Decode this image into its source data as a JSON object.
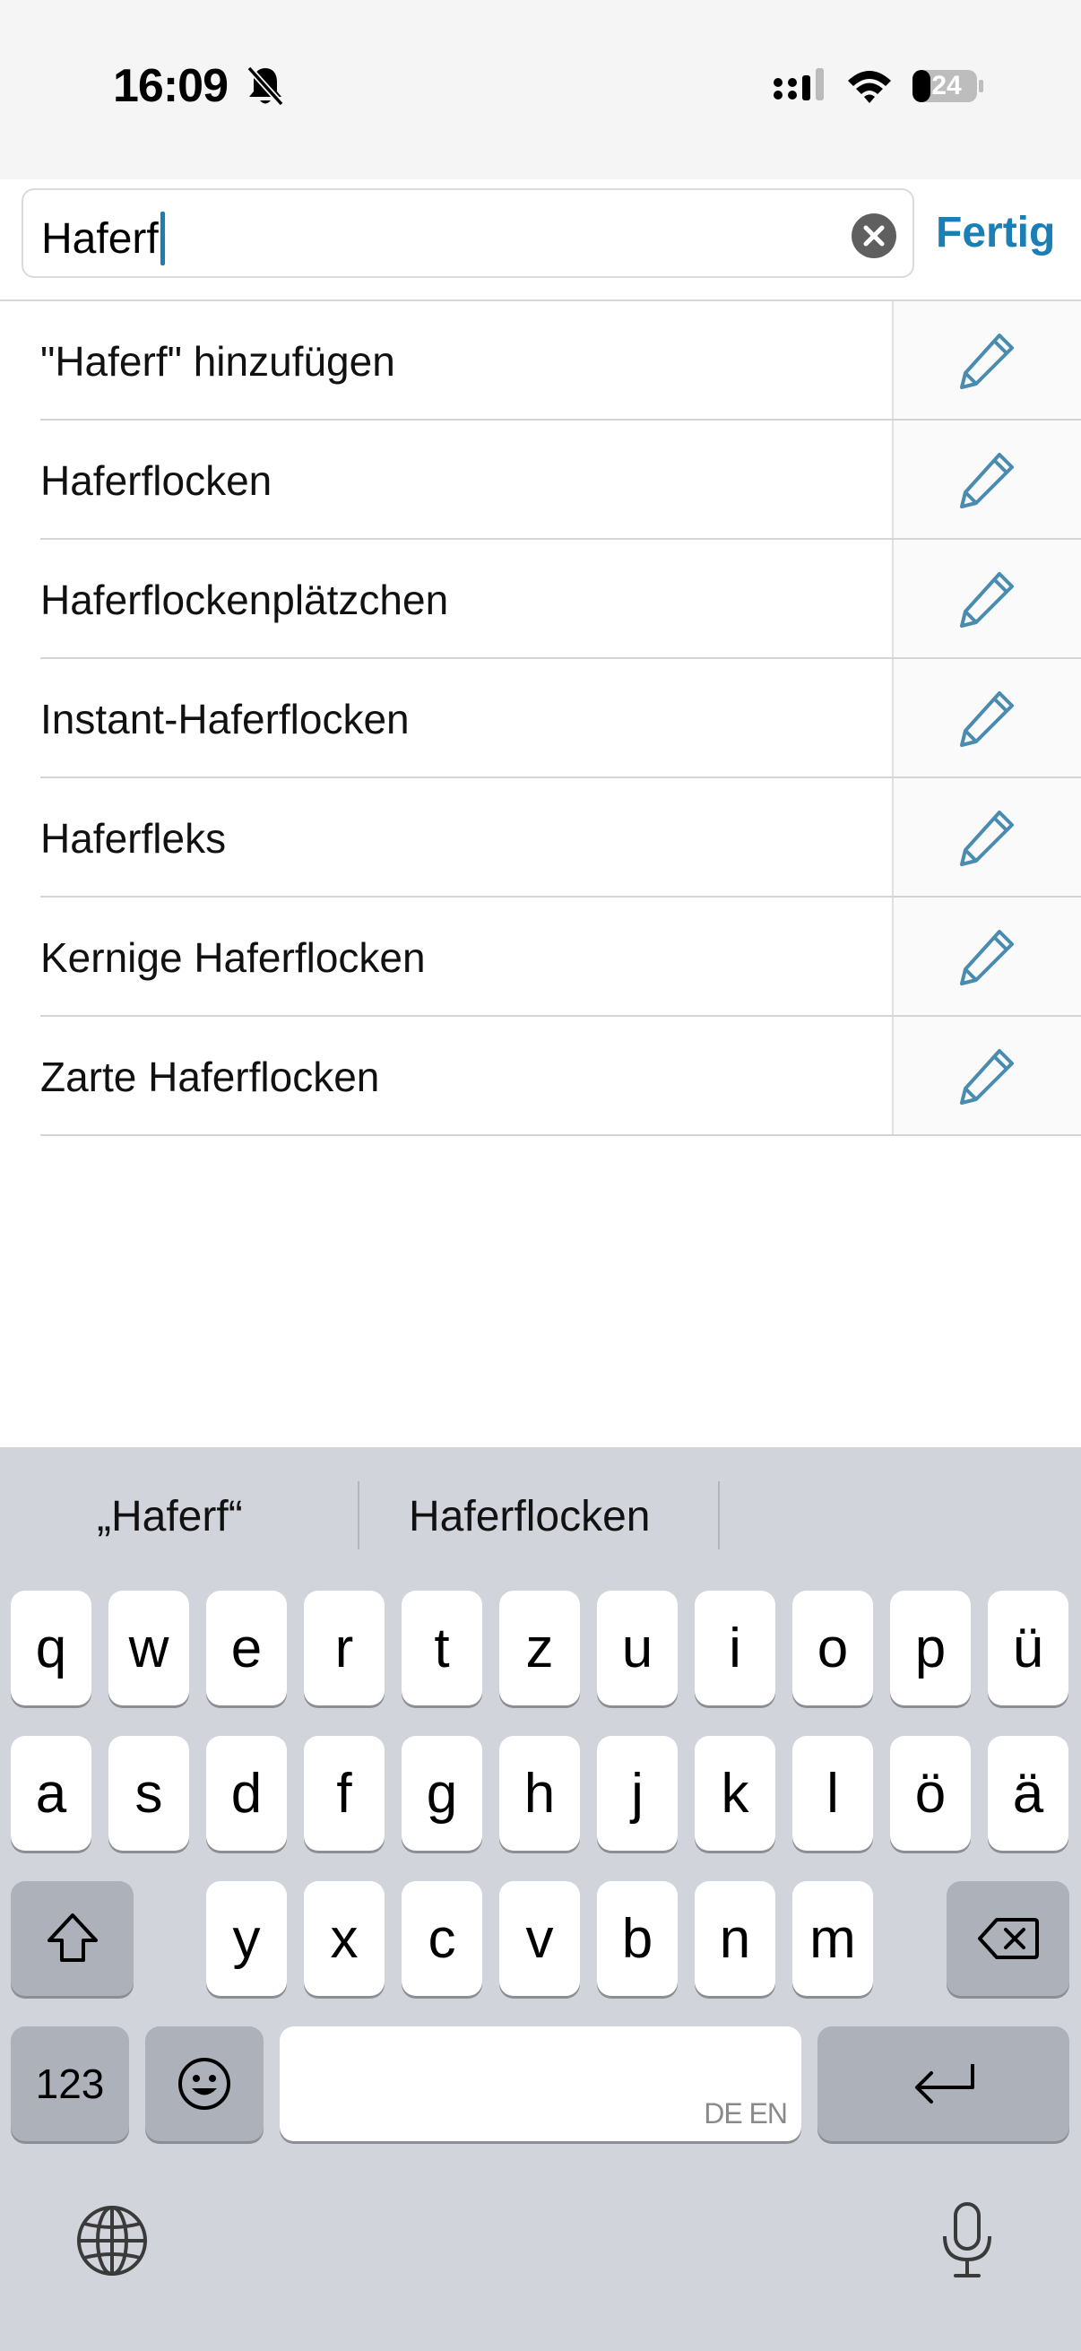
{
  "status_bar": {
    "time": "16:09",
    "battery": "24"
  },
  "search": {
    "value": "Haferf",
    "done_label": "Fertig"
  },
  "results": [
    {
      "label": "\"Haferf\" hinzufügen"
    },
    {
      "label": "Haferflocken"
    },
    {
      "label": "Haferflockenplätzchen"
    },
    {
      "label": "Instant-Haferflocken"
    },
    {
      "label": "Haferfleks"
    },
    {
      "label": "Kernige Haferflocken"
    },
    {
      "label": "Zarte Haferflocken"
    }
  ],
  "keyboard": {
    "suggestions": [
      "„Haferf“",
      "Haferflocken"
    ],
    "row1": [
      "q",
      "w",
      "e",
      "r",
      "t",
      "z",
      "u",
      "i",
      "o",
      "p",
      "ü"
    ],
    "row2": [
      "a",
      "s",
      "d",
      "f",
      "g",
      "h",
      "j",
      "k",
      "l",
      "ö",
      "ä"
    ],
    "row3": [
      "y",
      "x",
      "c",
      "v",
      "b",
      "n",
      "m"
    ],
    "numbers_key": "123",
    "space_hint": "DE EN"
  },
  "colors": {
    "accent": "#1b7fb5",
    "pencil": "#4a8bb0",
    "keyboard_bg": "#d1d4db"
  },
  "icons": [
    "bell-slash-icon",
    "signal-icon",
    "wifi-icon",
    "battery-icon",
    "clear-icon",
    "pencil-icon",
    "shift-icon",
    "delete-icon",
    "emoji-icon",
    "return-icon",
    "globe-icon",
    "microphone-icon"
  ]
}
